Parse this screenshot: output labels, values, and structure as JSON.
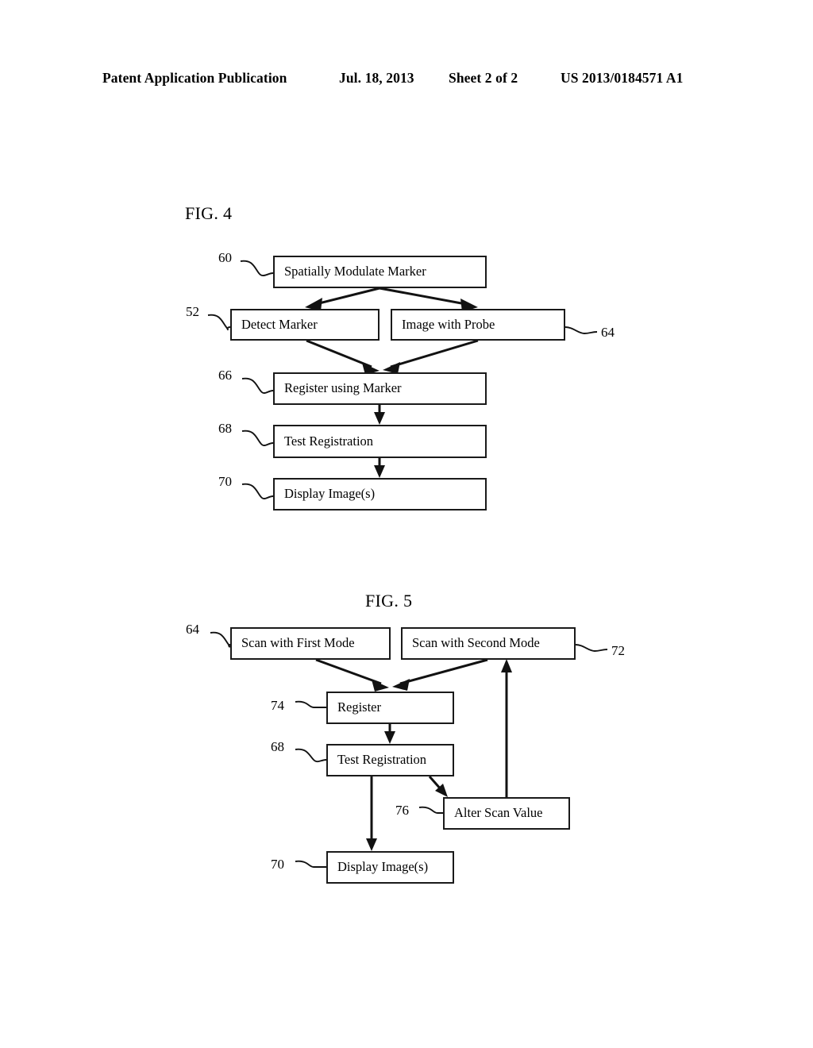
{
  "header": {
    "publication": "Patent Application Publication",
    "date": "Jul. 18, 2013",
    "sheet": "Sheet 2 of 2",
    "patent_number": "US 2013/0184571 A1"
  },
  "figures": [
    {
      "id": "fig4",
      "title": "FIG. 4",
      "nodes": [
        {
          "ref": "60",
          "label": "Spatially Modulate Marker"
        },
        {
          "ref": "52",
          "label": "Detect Marker"
        },
        {
          "ref": "64",
          "label": "Image with Probe"
        },
        {
          "ref": "66",
          "label": "Register using Marker"
        },
        {
          "ref": "68",
          "label": "Test Registration"
        },
        {
          "ref": "70",
          "label": "Display Image(s)"
        }
      ]
    },
    {
      "id": "fig5",
      "title": "FIG. 5",
      "nodes": [
        {
          "ref": "64",
          "label": "Scan with First Mode"
        },
        {
          "ref": "72",
          "label": "Scan with Second Mode"
        },
        {
          "ref": "74",
          "label": "Register"
        },
        {
          "ref": "68",
          "label": "Test Registration"
        },
        {
          "ref": "76",
          "label": "Alter Scan Value"
        },
        {
          "ref": "70",
          "label": "Display Image(s)"
        }
      ]
    }
  ],
  "colors": {
    "ink": "#121212",
    "paper": "#ffffff"
  }
}
